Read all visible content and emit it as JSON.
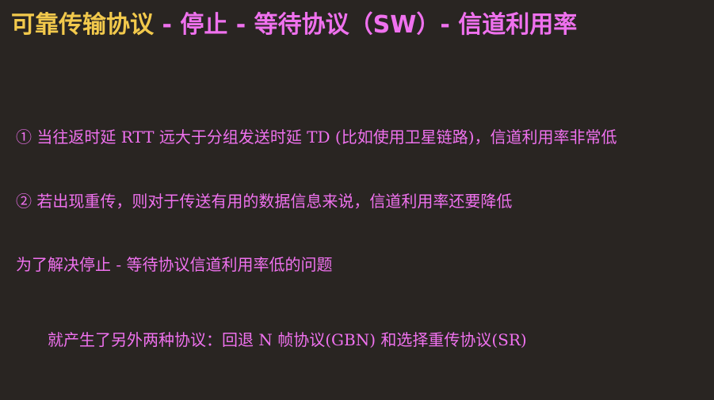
{
  "title": {
    "part_a": "可靠传输协议",
    "part_b": " - 停止 - 等待协议（SW）- 信道利用率"
  },
  "points": [
    "① 当往返时延 RTT 远大于分组发送时延 TD (比如使用卫星链路)，信道利用率非常低",
    "② 若出现重传，则对于传送有用的数据信息来说，信道利用率还要降低",
    "为了解决停止 - 等待协议信道利用率低的问题",
    "就产生了另外两种协议：回退 N 帧协议(GBN) 和选择重传协议(SR)"
  ],
  "colors": {
    "background": "#292522",
    "title_accent": "#f2c94c",
    "text": "#ef71ee"
  }
}
